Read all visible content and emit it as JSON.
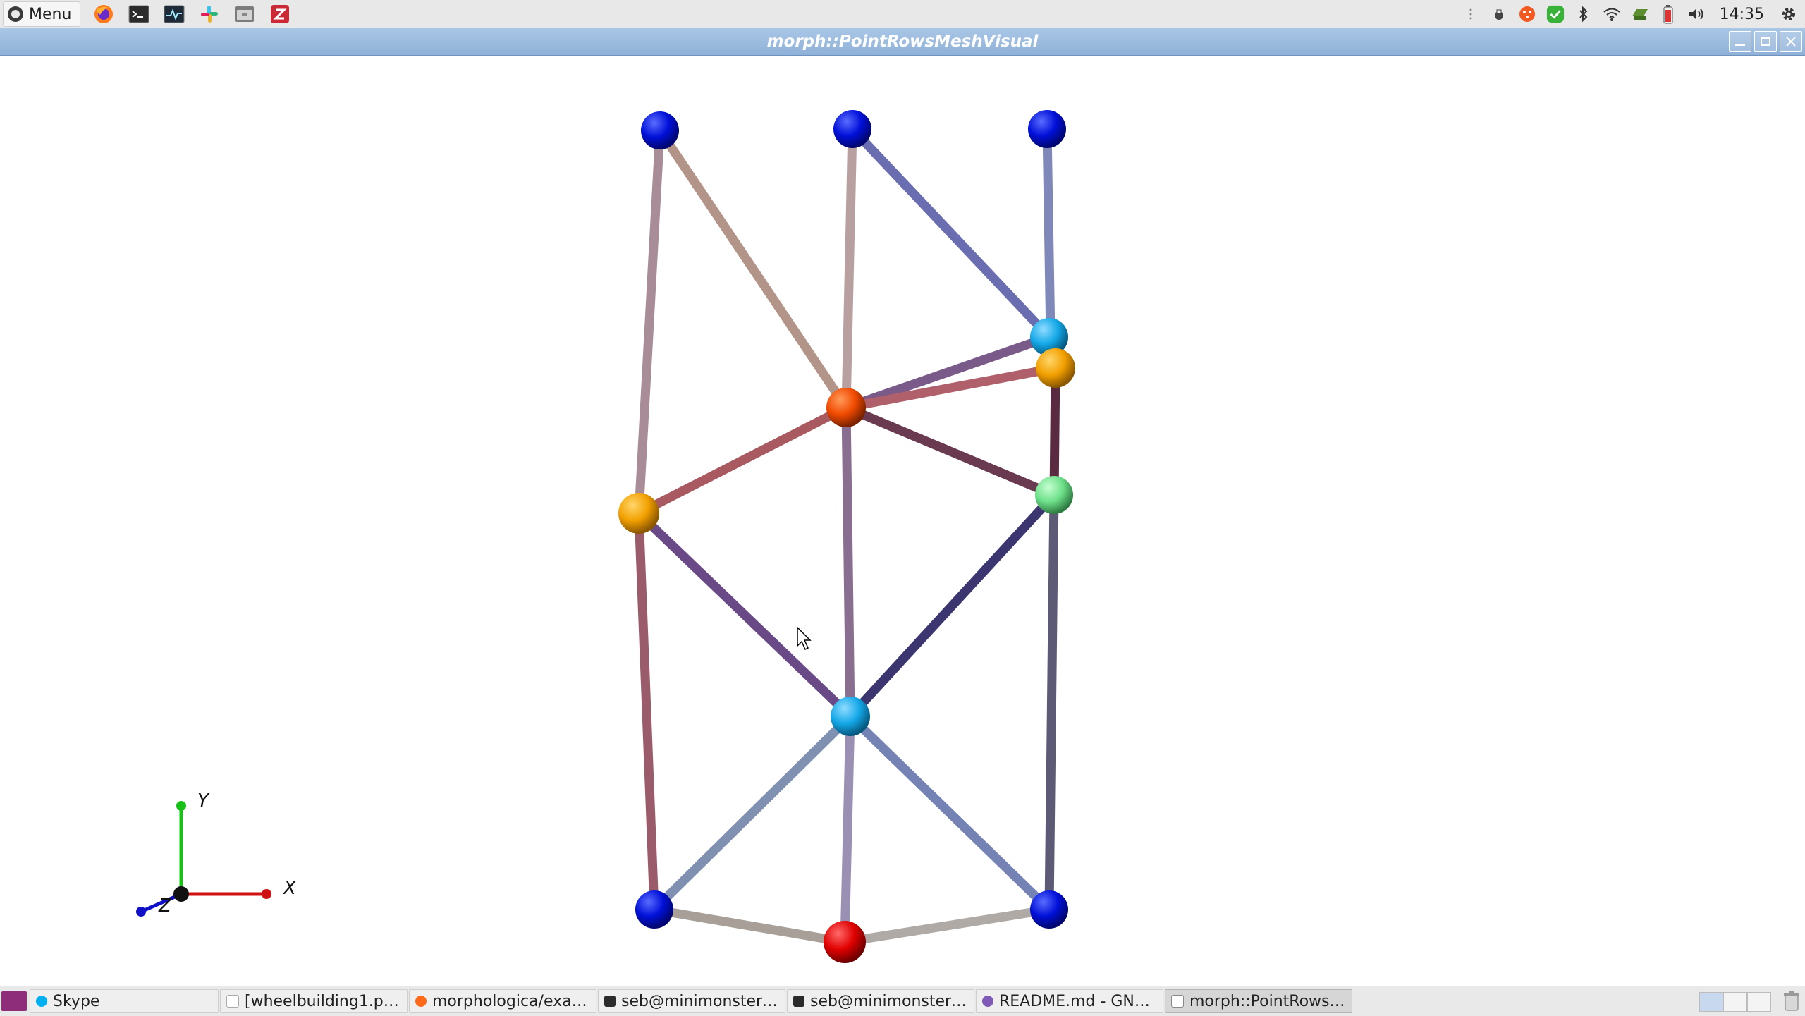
{
  "top_panel": {
    "menu_label": "Menu",
    "clock": "14:35",
    "launchers": [
      {
        "name": "firefox-icon"
      },
      {
        "name": "terminal-icon"
      },
      {
        "name": "system-monitor-icon"
      },
      {
        "name": "slack-icon"
      },
      {
        "name": "file-manager-icon"
      },
      {
        "name": "zotero-icon"
      }
    ],
    "tray": [
      {
        "name": "more-indicators-icon"
      },
      {
        "name": "printer-icon"
      },
      {
        "name": "app-tray-icon"
      },
      {
        "name": "update-ok-icon"
      },
      {
        "name": "bluetooth-icon"
      },
      {
        "name": "wifi-icon"
      },
      {
        "name": "network-icon"
      },
      {
        "name": "battery-icon"
      },
      {
        "name": "volume-icon"
      }
    ]
  },
  "window": {
    "title": "morph::PointRowsMeshVisual"
  },
  "scene": {
    "axes": {
      "x_label": "X",
      "y_label": "Y",
      "z_label": "Z"
    },
    "colors": {
      "blue": "#0010d8",
      "cyan": "#14a8e8",
      "orange": "#f2a000",
      "red_orange": "#f04a00",
      "green": "#6ee08a",
      "red": "#e00000"
    }
  },
  "taskbar": {
    "tasks": [
      {
        "label": "Skype",
        "icon": "skype-icon",
        "active": false
      },
      {
        "label": "[wheelbuilding1.pdf —...",
        "icon": "pdf-viewer-icon",
        "active": false
      },
      {
        "label": "morphologica/exampl...",
        "icon": "firefox-icon",
        "active": false
      },
      {
        "label": "seb@minimonster: ~/...",
        "icon": "terminal-icon",
        "active": false
      },
      {
        "label": "seb@minimonster: ~",
        "icon": "terminal-icon",
        "active": false
      },
      {
        "label": "README.md - GNU E...",
        "icon": "emacs-icon",
        "active": false
      },
      {
        "label": "morph::PointRowsMes...",
        "icon": "window-icon",
        "active": true
      }
    ]
  }
}
